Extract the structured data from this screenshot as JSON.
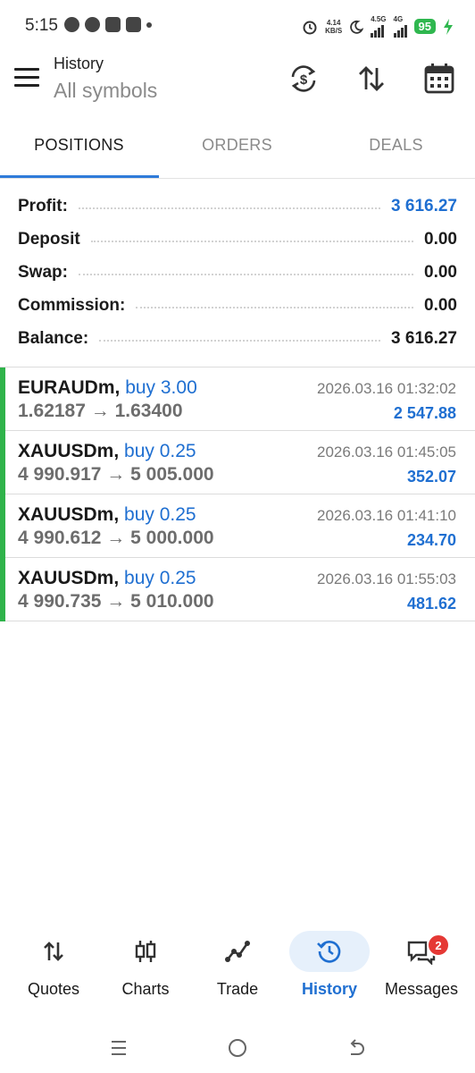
{
  "status_bar": {
    "time": "5:15",
    "net_speed_value": "4.14",
    "net_speed_unit": "KB/S",
    "signal1": "4.5G",
    "signal2": "4G",
    "battery": "95"
  },
  "header": {
    "title": "History",
    "subtitle": "All symbols"
  },
  "tabs": [
    {
      "label": "POSITIONS",
      "active": true
    },
    {
      "label": "ORDERS",
      "active": false
    },
    {
      "label": "DEALS",
      "active": false
    }
  ],
  "summary": {
    "profit_label": "Profit:",
    "profit_value": "3 616.27",
    "deposit_label": "Deposit",
    "deposit_value": "0.00",
    "swap_label": "Swap:",
    "swap_value": "0.00",
    "commission_label": "Commission:",
    "commission_value": "0.00",
    "balance_label": "Balance:",
    "balance_value": "3 616.27"
  },
  "trades": [
    {
      "symbol": "EURAUDm,",
      "side": "buy 3.00",
      "open": "1.62187",
      "arrow": "→",
      "close": "1.63400",
      "time": "2026.03.16 01:32:02",
      "profit": "2 547.88"
    },
    {
      "symbol": "XAUUSDm,",
      "side": "buy 0.25",
      "open": "4 990.917",
      "arrow": "→",
      "close": "5 005.000",
      "time": "2026.03.16 01:45:05",
      "profit": "352.07"
    },
    {
      "symbol": "XAUUSDm,",
      "side": "buy 0.25",
      "open": "4 990.612",
      "arrow": "→",
      "close": "5 000.000",
      "time": "2026.03.16 01:41:10",
      "profit": "234.70"
    },
    {
      "symbol": "XAUUSDm,",
      "side": "buy 0.25",
      "open": "4 990.735",
      "arrow": "→",
      "close": "5 010.000",
      "time": "2026.03.16 01:55:03",
      "profit": "481.62"
    }
  ],
  "bottom_nav": [
    {
      "label": "Quotes",
      "icon": "quotes-arrows-icon"
    },
    {
      "label": "Charts",
      "icon": "candlestick-icon"
    },
    {
      "label": "Trade",
      "icon": "trade-line-icon"
    },
    {
      "label": "History",
      "icon": "history-clock-icon",
      "active": true
    },
    {
      "label": "Messages",
      "icon": "messages-icon",
      "badge": "2"
    }
  ],
  "colors": {
    "accent": "#1f6fd1",
    "buy_bar": "#2fb34a",
    "active_pill": "#e6f0fb",
    "badge": "#e53935"
  }
}
